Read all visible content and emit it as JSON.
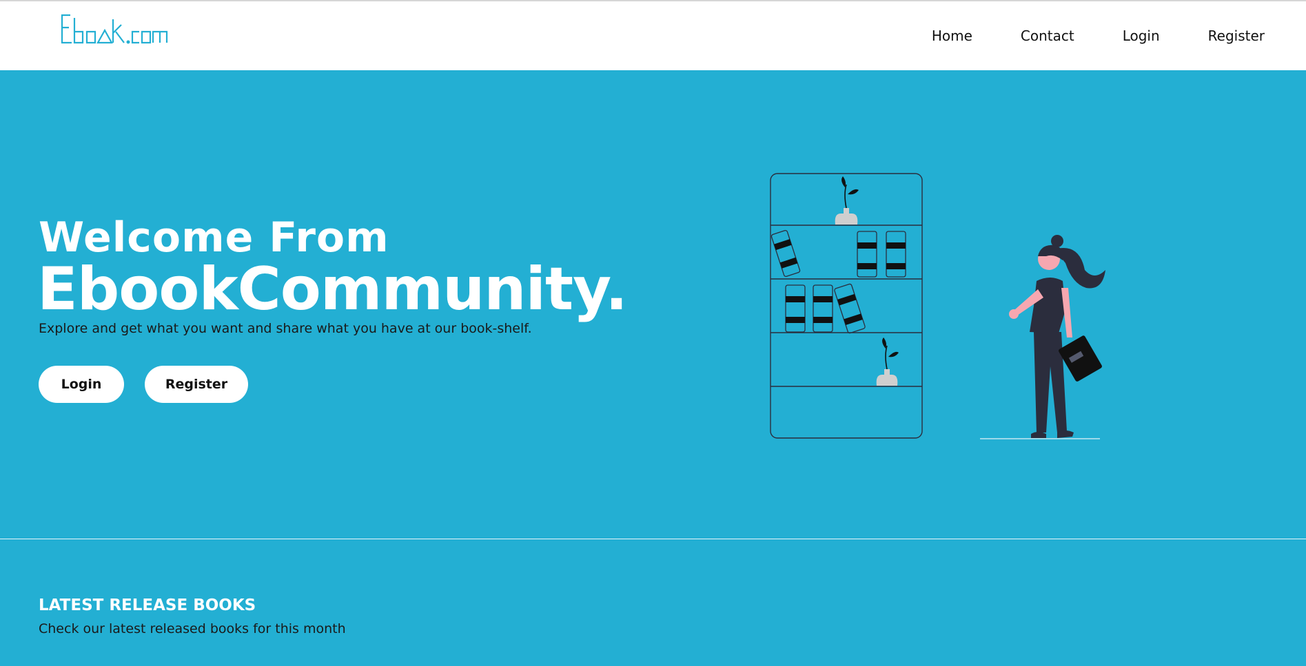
{
  "brand": {
    "logo_text": "Ebook.com",
    "accent_color": "#23afd3"
  },
  "nav": {
    "items": [
      {
        "label": "Home"
      },
      {
        "label": "Contact"
      },
      {
        "label": "Login"
      },
      {
        "label": "Register"
      }
    ]
  },
  "hero": {
    "welcome": "Welcome From",
    "title": "EbookCommunity.",
    "tagline": "Explore and get what you want and share what you have at our book-shelf.",
    "login_label": "Login",
    "register_label": "Register",
    "illustration_icon": "bookshelf-woman-illustration"
  },
  "latest": {
    "title": "LATEST RELEASE BOOKS",
    "subtitle": "Check our latest released books for this month"
  }
}
